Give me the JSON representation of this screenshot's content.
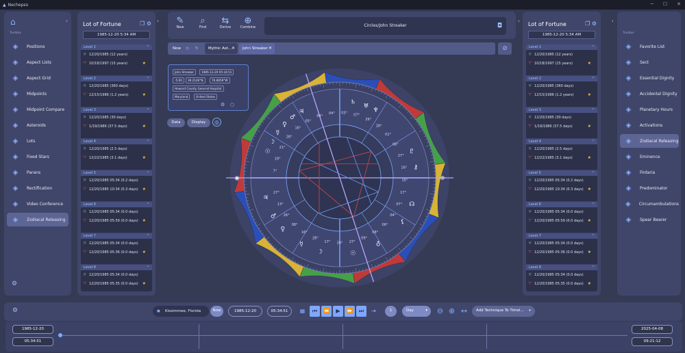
{
  "app": {
    "title": "Nechepso"
  },
  "left_nav": {
    "section": "Toolbox",
    "items": [
      {
        "label": "Positions",
        "icon": "positions-icon"
      },
      {
        "label": "Aspect Lists",
        "icon": "aspect-lists-icon"
      },
      {
        "label": "Aspect Grid",
        "icon": "aspect-grid-icon"
      },
      {
        "label": "Midpoints",
        "icon": "midpoints-icon"
      },
      {
        "label": "Midpoint Compare",
        "icon": "midpoint-compare-icon"
      },
      {
        "label": "Asteroids",
        "icon": "asteroids-icon"
      },
      {
        "label": "Lots",
        "icon": "lots-icon"
      },
      {
        "label": "Fixed Stars",
        "icon": "fixed-stars-icon"
      },
      {
        "label": "Parans",
        "icon": "parans-icon"
      },
      {
        "label": "Rectification",
        "icon": "rectification-icon"
      },
      {
        "label": "Video Conference",
        "icon": "video-conference-icon"
      },
      {
        "label": "Zodiacal Releasing",
        "icon": "zodiacal-releasing-icon",
        "active": true
      }
    ]
  },
  "right_nav": {
    "section": "Toolbox",
    "items": [
      {
        "label": "Favorite List",
        "icon": "favorite-list-icon"
      },
      {
        "label": "Sect",
        "icon": "sect-icon"
      },
      {
        "label": "Essential Dignity",
        "icon": "essential-dignity-icon"
      },
      {
        "label": "Accidental Dignity",
        "icon": "accidental-dignity-icon"
      },
      {
        "label": "Planetary Hours",
        "icon": "planetary-hours-icon"
      },
      {
        "label": "Activations",
        "icon": "activations-icon"
      },
      {
        "label": "Zodiacal Releasing",
        "icon": "zodiacal-releasing-icon",
        "active": true
      },
      {
        "label": "Eminence",
        "icon": "eminence-icon"
      },
      {
        "label": "Firdaria",
        "icon": "firdaria-icon"
      },
      {
        "label": "Predominator",
        "icon": "predominator-icon"
      },
      {
        "label": "Circumambulations",
        "icon": "circumambulations-icon"
      },
      {
        "label": "Spear Bearer",
        "icon": "spear-bearer-icon"
      }
    ]
  },
  "lot_left": {
    "title": "Lot of Fortune",
    "date": "1985-12-20 5:34 AM",
    "levels": [
      {
        "name": "Level 1",
        "rows": [
          {
            "sign": "♓",
            "text": "12/20/1985 (12 years)",
            "star": false
          },
          {
            "sign": "♈",
            "text": "10/18/1997 (15 years)",
            "star": true
          }
        ]
      },
      {
        "name": "Level 2",
        "rows": [
          {
            "sign": "♓",
            "text": "12/20/1985 (360 days)",
            "star": false
          },
          {
            "sign": "♈",
            "text": "12/15/1986 (1.2 years)",
            "star": true
          }
        ]
      },
      {
        "name": "Level 3",
        "rows": [
          {
            "sign": "♓",
            "text": "12/20/1985 (30 days)",
            "star": false
          },
          {
            "sign": "♈",
            "text": "1/19/1986 (37.5 days)",
            "star": true
          }
        ]
      },
      {
        "name": "Level 4",
        "rows": [
          {
            "sign": "♓",
            "text": "12/20/1985 (2.5 days)",
            "star": false
          },
          {
            "sign": "♈",
            "text": "12/22/1985 (3.1 days)",
            "star": true
          }
        ]
      },
      {
        "name": "Level 5",
        "rows": [
          {
            "sign": "♓",
            "text": "12/20/1985 05:34 (0.2 days)",
            "star": false
          },
          {
            "sign": "♈",
            "text": "12/20/1985 10:34 (0.3 days)",
            "star": true
          }
        ]
      },
      {
        "name": "Level 6",
        "rows": [
          {
            "sign": "♓",
            "text": "12/20/1985 05:34 (0.0 days)",
            "star": false
          },
          {
            "sign": "♈",
            "text": "12/20/1985 05:59 (0.0 days)",
            "star": true
          }
        ]
      },
      {
        "name": "Level 7",
        "rows": [
          {
            "sign": "♓",
            "text": "12/20/1985 05:34 (0.0 days)",
            "star": false
          },
          {
            "sign": "♈",
            "text": "12/20/1985 05:36 (0.0 days)",
            "star": true
          }
        ]
      },
      {
        "name": "Level 8",
        "rows": [
          {
            "sign": "♓",
            "text": "12/20/1985 05:34 (0.0 days)",
            "star": false
          },
          {
            "sign": "♈",
            "text": "12/20/1985 05:35 (0.0 days)",
            "star": true
          }
        ]
      }
    ]
  },
  "lot_right": {
    "title": "Lot of Fortune",
    "date": "1985-12-20 5:34 AM",
    "levels": [
      {
        "name": "Level 1",
        "rows": [
          {
            "sign": "♓",
            "text": "12/20/1985 (12 years)",
            "star": false
          },
          {
            "sign": "♈",
            "text": "10/18/1997 (15 years)",
            "star": true
          }
        ]
      },
      {
        "name": "Level 2",
        "rows": [
          {
            "sign": "♓",
            "text": "12/20/1985 (360 days)",
            "star": false
          },
          {
            "sign": "♈",
            "text": "12/15/1986 (1.2 years)",
            "star": true
          }
        ]
      },
      {
        "name": "Level 3",
        "rows": [
          {
            "sign": "♓",
            "text": "12/20/1985 (30 days)",
            "star": false
          },
          {
            "sign": "♈",
            "text": "1/19/1986 (37.5 days)",
            "star": true
          }
        ]
      },
      {
        "name": "Level 4",
        "rows": [
          {
            "sign": "♓",
            "text": "12/20/1985 (2.5 days)",
            "star": false
          },
          {
            "sign": "♈",
            "text": "12/22/1985 (3.1 days)",
            "star": true
          }
        ]
      },
      {
        "name": "Level 5",
        "rows": [
          {
            "sign": "♓",
            "text": "12/20/1985 05:34 (0.2 days)",
            "star": false
          },
          {
            "sign": "♈",
            "text": "12/20/1985 10:34 (0.3 days)",
            "star": true
          }
        ]
      },
      {
        "name": "Level 6",
        "rows": [
          {
            "sign": "♓",
            "text": "12/20/1985 05:34 (0.0 days)",
            "star": false
          },
          {
            "sign": "♈",
            "text": "12/20/1985 05:59 (0.0 days)",
            "star": true
          }
        ]
      },
      {
        "name": "Level 7",
        "rows": [
          {
            "sign": "♓",
            "text": "12/20/1985 05:34 (0.0 days)",
            "star": false
          },
          {
            "sign": "♈",
            "text": "12/20/1985 05:36 (0.0 days)",
            "star": true
          }
        ]
      },
      {
        "name": "Level 8",
        "rows": [
          {
            "sign": "♓",
            "text": "12/20/1985 05:34 (0.0 days)",
            "star": false
          },
          {
            "sign": "♈",
            "text": "12/20/1985 05:35 (0.0 days)",
            "star": true
          }
        ]
      }
    ]
  },
  "toolbar": {
    "new": "New",
    "find": "Find",
    "derive": "Derive",
    "combine": "Combine",
    "chart_name": "Circles/John Streaker"
  },
  "tabs": {
    "now": "Now",
    "tab1": "Mythic Ast...",
    "tab2": "John Streaker"
  },
  "info": {
    "name": "John Streaker",
    "datetime": "1985-12-20 05:34:51",
    "tz": "-5:00",
    "lat": "39.2146°N",
    "lon": "76.8659°W",
    "place": "Howard County General Hospital",
    "state": "Maryland",
    "country": "United States"
  },
  "view": {
    "data": "Data",
    "display": "Display"
  },
  "chart_labels": {
    "deg": [
      "7°",
      "19°",
      "21°",
      "28°",
      "16°",
      "05°",
      "04°",
      "04°",
      "03°",
      "07°",
      "29°",
      "28°",
      "01°",
      "08°",
      "27°",
      "16°",
      "15°",
      "17°",
      "07°",
      "04°",
      "06°",
      "08°",
      "09°",
      "27°",
      "26°",
      "17°",
      "28°",
      "16°",
      "08°",
      "26°",
      "13°",
      "27°"
    ]
  },
  "bottom": {
    "location": "Kissimmee, Florida",
    "now": "Now",
    "date": "1985-12-20",
    "time": "05:34:51",
    "step_num": "1",
    "step_unit": "Day",
    "add_tech": "Add Technique To Timel..."
  },
  "timeline": {
    "start_date": "1985-12-20",
    "start_time": "05:34:51",
    "end_date": "2025-04-08",
    "end_time": "09:21:12"
  },
  "colors": {
    "fire": "#c03a3a",
    "earth": "#45a048",
    "air": "#d8b336",
    "water": "#2a4fb8",
    "accent": "#8fb0ff"
  }
}
